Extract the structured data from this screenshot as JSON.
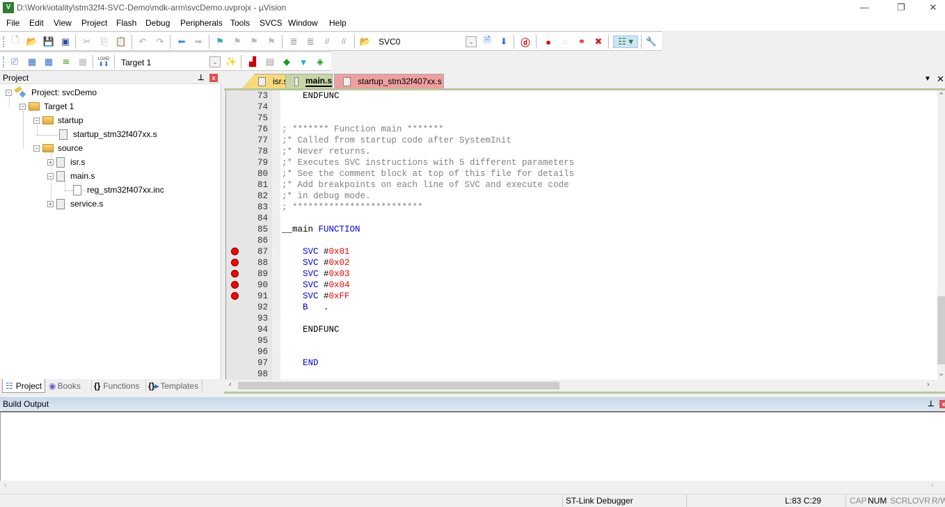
{
  "window": {
    "title": "D:\\Work\\iotality\\stm32f4-SVC-Demo\\mdk-arm\\svcDemo.uvprojx - µVision",
    "app_icon": "uvision-icon",
    "controls": {
      "minimize": "—",
      "restore": "❐",
      "close": "✕"
    }
  },
  "menu": [
    "File",
    "Edit",
    "View",
    "Project",
    "Flash",
    "Debug",
    "Peripherals",
    "Tools",
    "SVCS",
    "Window",
    "Help"
  ],
  "toolbar1": {
    "icons": [
      "new-file-icon",
      "open-file-icon",
      "save-icon",
      "save-all-icon",
      "cut-icon",
      "copy-icon",
      "paste-icon",
      "undo-icon",
      "redo-icon",
      "navigate-back-icon",
      "navigate-forward-icon",
      "insert-bookmark-icon",
      "previous-bookmark-icon",
      "next-bookmark-icon",
      "clear-bookmarks-icon",
      "indent-icon",
      "unindent-icon",
      "comment-icon",
      "uncomment-icon",
      "find-in-files-icon"
    ],
    "find_combo_value": "SVC0",
    "right_icons": [
      "find-icon",
      "incremental-find-icon",
      "debug-session-icon",
      "insert-breakpoint-icon",
      "enable-breakpoint-icon",
      "disable-all-breakpoints-icon",
      "kill-all-breakpoints-icon",
      "window-layout-icon",
      "configure-icon"
    ]
  },
  "toolbar2": {
    "icons": [
      "translate-icon",
      "build-icon",
      "rebuild-icon",
      "batch-build-icon",
      "stop-build-icon",
      "download-icon"
    ],
    "load_label": "LOAD",
    "target_combo_value": "Target 1",
    "right_icons": [
      "target-options-icon",
      "file-extensions-icon",
      "manage-components-icon",
      "select-pack-icon",
      "pack-installer-icon",
      "manage-rte-icon"
    ]
  },
  "project_panel": {
    "title": "Project",
    "tree": [
      {
        "label": "Project: svcDemo",
        "type": "project",
        "expanded": true,
        "level": 0
      },
      {
        "label": "Target 1",
        "type": "target",
        "expanded": true,
        "level": 1
      },
      {
        "label": "startup",
        "type": "folder",
        "expanded": true,
        "level": 2
      },
      {
        "label": "startup_stm32f407xx.s",
        "type": "file",
        "level": 3
      },
      {
        "label": "source",
        "type": "folder",
        "expanded": true,
        "level": 2
      },
      {
        "label": "isr.s",
        "type": "file",
        "expandable": true,
        "expanded": false,
        "level": 3
      },
      {
        "label": "main.s",
        "type": "file",
        "expandable": true,
        "expanded": true,
        "level": 3
      },
      {
        "label": "reg_stm32f407xx.inc",
        "type": "include",
        "level": 4
      },
      {
        "label": "service.s",
        "type": "file",
        "expandable": true,
        "expanded": false,
        "level": 3
      }
    ],
    "tabs": [
      {
        "label": "Project",
        "active": true
      },
      {
        "label": "Books",
        "active": false
      },
      {
        "label": "Functions",
        "active": false
      },
      {
        "label": "Templates",
        "active": false
      }
    ]
  },
  "editor": {
    "tabs": [
      {
        "label": "isr.s",
        "color": "#f8d97a",
        "active": false
      },
      {
        "label": "main.s",
        "color": "#c7d6a4",
        "active": true
      },
      {
        "label": "startup_stm32f407xx.s",
        "color": "#ef9fa0",
        "active": false
      }
    ],
    "lines": [
      {
        "n": "73",
        "bp": false,
        "tokens": [
          [
            "    ENDFUNC",
            "plain"
          ]
        ]
      },
      {
        "n": "74",
        "bp": false,
        "tokens": []
      },
      {
        "n": "75",
        "bp": false,
        "tokens": []
      },
      {
        "n": "76",
        "bp": false,
        "tokens": [
          [
            "; ******* Function main *******",
            "comment"
          ]
        ]
      },
      {
        "n": "77",
        "bp": false,
        "tokens": [
          [
            ";* Called from startup code after SystemInit",
            "comment"
          ]
        ]
      },
      {
        "n": "78",
        "bp": false,
        "tokens": [
          [
            ";* Never returns.",
            "comment"
          ]
        ]
      },
      {
        "n": "79",
        "bp": false,
        "tokens": [
          [
            ";* Executes SVC instructions with 5 different parameters",
            "comment"
          ]
        ]
      },
      {
        "n": "80",
        "bp": false,
        "tokens": [
          [
            ";* See the comment block at top of this file for details",
            "comment"
          ]
        ]
      },
      {
        "n": "81",
        "bp": false,
        "tokens": [
          [
            ";* Add breakpoints on each line of SVC and execute code",
            "comment"
          ]
        ]
      },
      {
        "n": "82",
        "bp": false,
        "tokens": [
          [
            ";* in debug mode.",
            "comment"
          ]
        ]
      },
      {
        "n": "83",
        "bp": false,
        "tokens": [
          [
            "; *************************",
            "comment"
          ]
        ]
      },
      {
        "n": "84",
        "bp": false,
        "tokens": []
      },
      {
        "n": "85",
        "bp": false,
        "tokens": [
          [
            "__main ",
            "plain"
          ],
          [
            "FUNCTION",
            "kw"
          ]
        ]
      },
      {
        "n": "86",
        "bp": false,
        "tokens": []
      },
      {
        "n": "87",
        "bp": true,
        "tokens": [
          [
            "    ",
            "plain"
          ],
          [
            "SVC",
            "kw"
          ],
          [
            " #",
            "plain"
          ],
          [
            "0x01",
            "num"
          ]
        ]
      },
      {
        "n": "88",
        "bp": true,
        "tokens": [
          [
            "    ",
            "plain"
          ],
          [
            "SVC",
            "kw"
          ],
          [
            " #",
            "plain"
          ],
          [
            "0x02",
            "num"
          ]
        ]
      },
      {
        "n": "89",
        "bp": true,
        "tokens": [
          [
            "    ",
            "plain"
          ],
          [
            "SVC",
            "kw"
          ],
          [
            " #",
            "plain"
          ],
          [
            "0x03",
            "num"
          ]
        ]
      },
      {
        "n": "90",
        "bp": true,
        "tokens": [
          [
            "    ",
            "plain"
          ],
          [
            "SVC",
            "kw"
          ],
          [
            " #",
            "plain"
          ],
          [
            "0x04",
            "num"
          ]
        ]
      },
      {
        "n": "91",
        "bp": true,
        "tokens": [
          [
            "    ",
            "plain"
          ],
          [
            "SVC",
            "kw"
          ],
          [
            " #",
            "plain"
          ],
          [
            "0xFF",
            "num"
          ]
        ]
      },
      {
        "n": "92",
        "bp": false,
        "tokens": [
          [
            "    ",
            "plain"
          ],
          [
            "B",
            "kw"
          ],
          [
            "   .",
            "plain"
          ]
        ]
      },
      {
        "n": "93",
        "bp": false,
        "tokens": []
      },
      {
        "n": "94",
        "bp": false,
        "tokens": [
          [
            "    ENDFUNC",
            "plain"
          ]
        ]
      },
      {
        "n": "95",
        "bp": false,
        "tokens": []
      },
      {
        "n": "96",
        "bp": false,
        "tokens": []
      },
      {
        "n": "97",
        "bp": false,
        "tokens": [
          [
            "    ",
            "plain"
          ],
          [
            "END",
            "kw"
          ]
        ]
      },
      {
        "n": "98",
        "bp": false,
        "tokens": []
      }
    ]
  },
  "build_output": {
    "title": "Build Output",
    "content": ""
  },
  "statusbar": {
    "debugger": "ST-Link Debugger",
    "position": "L:83 C:29",
    "indicators": [
      {
        "label": "CAP",
        "active": false
      },
      {
        "label": "NUM",
        "active": true
      },
      {
        "label": "SCRL",
        "active": false
      },
      {
        "label": "OVR",
        "active": false
      },
      {
        "label": "R/W",
        "active": false
      }
    ]
  }
}
